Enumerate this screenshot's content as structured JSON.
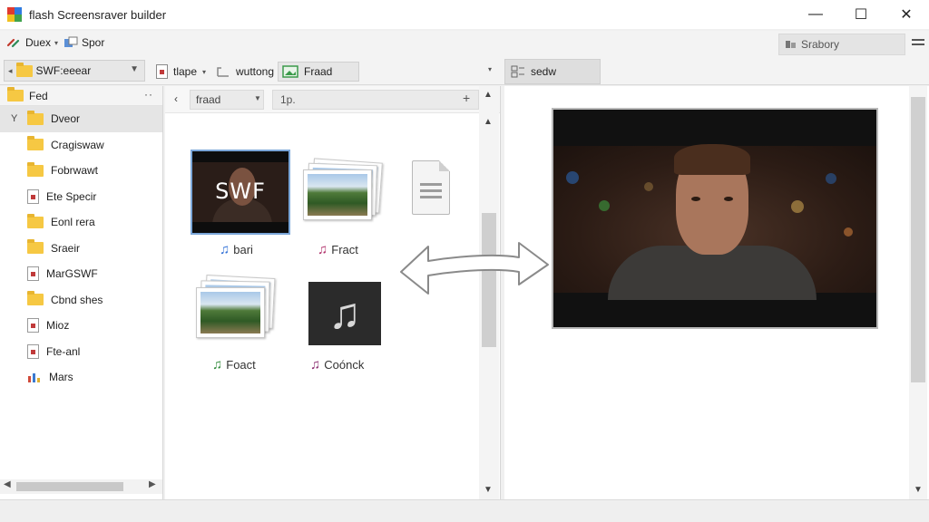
{
  "window": {
    "title": "flash Screensraver builder",
    "controls": {
      "minimize": "—",
      "maximize": "☐",
      "close": "✕"
    }
  },
  "toolbar": {
    "items": [
      {
        "label": "Duex",
        "icon": "link-icon",
        "has_dropdown": true
      },
      {
        "label": "Spor",
        "icon": "export-icon",
        "has_dropdown": false
      }
    ],
    "search": {
      "label": "Srabory",
      "icon": "search-icon"
    },
    "menu_icon": "hamburger-menu-icon"
  },
  "toolbar2": {
    "folder_combo": {
      "value": "SWF:eeear",
      "icon": "folder-icon"
    },
    "items": [
      {
        "label": "tlape",
        "icon": "page-icon",
        "has_dropdown": true
      },
      {
        "label": "wuttong",
        "icon": "tool-icon",
        "has_dropdown": false
      },
      {
        "label": "Fraad",
        "icon": "image-icon",
        "active": true
      }
    ],
    "right_tab": {
      "label": "sedw",
      "icon": "grid-icon"
    }
  },
  "left_panel": {
    "header": {
      "label": "Fed",
      "more": "··"
    },
    "tree": [
      {
        "label": "Dveor",
        "icon": "folder-icon",
        "type": "folder",
        "selected": true,
        "expander": "Y"
      },
      {
        "label": "Cragiswaw",
        "icon": "folder-icon",
        "type": "folder"
      },
      {
        "label": "Fobrwawt",
        "icon": "folder-icon",
        "type": "folder"
      },
      {
        "label": "Ete Specir",
        "icon": "document-icon",
        "type": "file"
      },
      {
        "label": "Eonl rera",
        "icon": "folder-icon",
        "type": "folder"
      },
      {
        "label": "Sraeir",
        "icon": "folder-icon",
        "type": "folder"
      },
      {
        "label": "MarGSWF",
        "icon": "document-icon",
        "type": "file"
      },
      {
        "label": "Cbnd shes",
        "icon": "folder-icon",
        "type": "folder"
      },
      {
        "label": "Mioz",
        "icon": "document-icon",
        "type": "file"
      },
      {
        "label": "Fte-anl",
        "icon": "document-icon",
        "type": "file"
      },
      {
        "label": "Mars",
        "icon": "chart-icon",
        "type": "file"
      }
    ]
  },
  "mid_panel": {
    "nav": {
      "back": "‹",
      "address": "fraad",
      "path": "1p.",
      "plus": "+"
    },
    "files": [
      {
        "label": "bari",
        "kind": "video",
        "overlay": "SWF",
        "note_color": "#2f6fd6"
      },
      {
        "label": "Fract",
        "kind": "photos",
        "note_color": "#b0306a"
      },
      {
        "label": "",
        "kind": "document"
      },
      {
        "label": "Foact",
        "kind": "photos",
        "note_color": "#2f8a3a"
      },
      {
        "label": "Coónck",
        "kind": "music",
        "note_color": "#8a2e70"
      }
    ]
  },
  "colors": {
    "accent": "#7aa6d8",
    "folder": "#f6c843",
    "note_blue": "#2f6fd6",
    "note_pink": "#b0306a",
    "note_green": "#2f8a3a",
    "note_purple": "#8a2e70"
  }
}
